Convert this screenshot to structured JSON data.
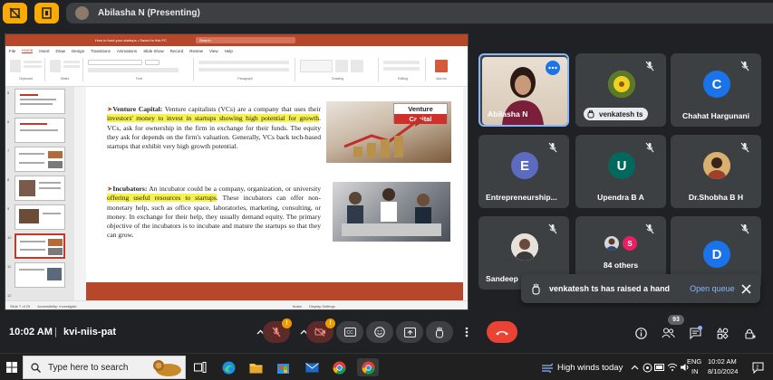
{
  "topbar": {
    "presenter_name": "Abilasha N (Presenting)"
  },
  "powerpoint": {
    "window_title": "How to fund your startups • Saved to this PC",
    "search_placeholder": "Search",
    "menu": [
      "File",
      "Home",
      "Insert",
      "Draw",
      "Design",
      "Transitions",
      "Animations",
      "Slide Show",
      "Record",
      "Review",
      "View",
      "Help"
    ],
    "active_menu": "Home",
    "ribbon_groups": [
      "Clipboard",
      "Slides",
      "Font",
      "Paragraph",
      "Drawing",
      "Editing",
      "Add-ins"
    ],
    "thumbnail_numbers": [
      "5",
      "6",
      "7",
      "8",
      "9",
      "10",
      "11",
      "12"
    ],
    "slide": {
      "vc_title": "Venture Capital:",
      "vc_text_1": " Venture capitalists (VCs) are a company that uses their ",
      "vc_highlight": "investors' money to invest in startups showing high potential for growth",
      "vc_text_2": ". VCs, ask for ownership in the firm in exchange for their funds. The equity they ask for depends on the firm's valuation. Generally, VCs back tech-based startups that exhibit very high growth potential.",
      "vc_image_label_1": "Venture",
      "vc_image_label_2": "Capital",
      "inc_title": "Incubators:",
      "inc_text_1": " An incubator could be a company, organization, or university ",
      "inc_highlight": "offering useful resources to startups",
      "inc_text_2": ". These incubators can offer non-monetary help, such as office space, laboratories, marketing, consulting, or money. In exchange for their help, they usually demand equity. The primary objective of the incubators is to incubate and mature the startups so that they can grow."
    },
    "status": {
      "slide_of": "Slide 7 of 29",
      "accessibility": "Accessibility: Investigate",
      "notes": "Notes",
      "display_settings": "Display Settings"
    }
  },
  "participants": [
    {
      "name": "Abilasha N",
      "type": "video"
    },
    {
      "name": "venkatesh ts",
      "type": "image-avatar"
    },
    {
      "name": "Chahat Hargunani",
      "initial": "C",
      "color": "#1a73e8"
    },
    {
      "name": "Entrepreneurship...",
      "initial": "E",
      "color": "#5c6bc0"
    },
    {
      "name": "Upendra B A",
      "initial": "U",
      "color": "#00695c"
    },
    {
      "name": "Dr.Shobha B H",
      "type": "image-avatar"
    },
    {
      "name": "Sandeep",
      "type": "image-avatar"
    },
    {
      "name": "84 others",
      "initial": "S",
      "color": "#e91e63"
    },
    {
      "name": "",
      "initial": "D",
      "color": "#1a73e8"
    }
  ],
  "toast": {
    "message": "venkatesh ts has raised a hand",
    "action": "Open queue"
  },
  "controls": {
    "time": "10:02 AM",
    "separator": "|",
    "meeting_code": "kvi-niis-pat",
    "mic_badge": "!",
    "cam_badge": "!",
    "people_count": "93"
  },
  "taskbar": {
    "search_placeholder": "Type here to search",
    "weather": "High winds today",
    "lang_1": "ENG",
    "lang_2": "IN",
    "clock_time": "10:02 AM",
    "clock_date": "8/10/2024"
  },
  "colors": {
    "ppt_accent": "#b7472a",
    "highlight": "#f7f24a",
    "meet_bg": "#202124",
    "tile_bg": "#3c4043",
    "end_call": "#ea4335",
    "link_blue": "#8ab4f8"
  }
}
